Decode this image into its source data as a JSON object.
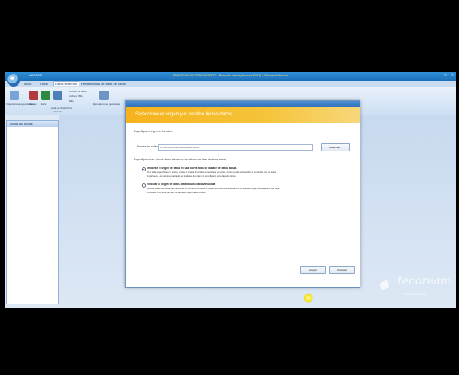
{
  "window": {
    "app_name": "ACCESS",
    "title": "EMPRESA DE TRANSPORTE : Base de datos (Access 2007) - Microsoft Access",
    "controls": [
      "–",
      "□",
      "✕"
    ]
  },
  "ribbon": {
    "tabs": [
      "Inicio",
      "Crear",
      "Datos externos",
      "Herramientas de base de datos"
    ],
    "active_tab_index": 2,
    "groups": [
      "Importaciones guardadas",
      "Access",
      "Excel",
      "Lista de SharePoint",
      "Archivo de texto",
      "Archivo XML",
      "Más",
      "Exportaciones guardadas"
    ],
    "group_label": "Importar"
  },
  "nav_pane": {
    "header": "Todas las tablas"
  },
  "dialog": {
    "titlebar": "Obtener datos externos - Base de datos Access",
    "banner": "Seleccione el origen y el destino de los datos",
    "source_label": "Especifique el origen de los datos.",
    "file_label": "Nombre de archivo:",
    "file_value": "C:\\Users\\Documents\\Empleados.accdb",
    "browse_button": "Examinar...",
    "how_label": "Especifique cómo y dónde desea almacenar los datos en la base de datos actual.",
    "option1_title": "Importar el origen de datos en una nueva tabla de la base de datos actual.",
    "option1_desc1": "Si la tabla especificada no existe, Access la creará. Si la tabla especificada ya existe, Access puede sobrescribir su contenido con los datos",
    "option1_desc2": "importados. Los cambios realizados en los datos de origen no se reflejarán en la base de datos.",
    "option2_title": "Vincular al origen de datos creando una tabla vinculada.",
    "option2_desc1": "Access creará una tabla que mantendrá un vínculo a los datos de origen. Los cambios realizados a los datos de origen se reflejarán en la tabla",
    "option2_desc2": "vinculada. No podrá cambiar los datos de origen desde Access.",
    "ok_button": "Aceptar",
    "cancel_button": "Cancelar"
  },
  "watermark": {
    "brand": "tecoream",
    "sub": "aprender es prioritario"
  },
  "colors": {
    "banner": "#f6b21b",
    "titlebar": "#2f8fd8",
    "workspace": "#c7d9ef"
  }
}
